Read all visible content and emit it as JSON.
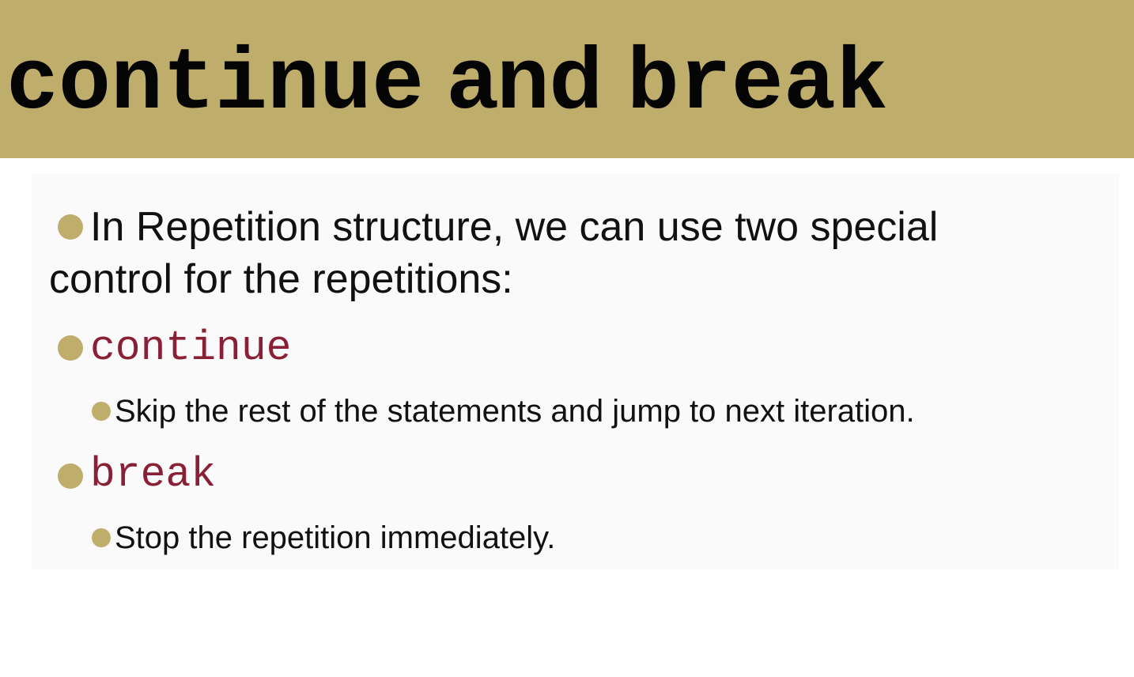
{
  "slide": {
    "title": {
      "keyword_continue": "continue",
      "connector": "and",
      "keyword_break": "break"
    },
    "bullets": {
      "intro_line1": "In Repetition structure, we can use two special",
      "intro_line2": "control for the repetitions:",
      "continue_label": "continue",
      "continue_desc": "Skip the rest of the statements and jump to next iteration.",
      "break_label": "break",
      "break_desc": "Stop the repetition immediately."
    }
  },
  "colors": {
    "title_bar": "#bfad6b",
    "bullet": "#bfad6b",
    "code_text": "#8a2035",
    "body_text": "#111111"
  }
}
